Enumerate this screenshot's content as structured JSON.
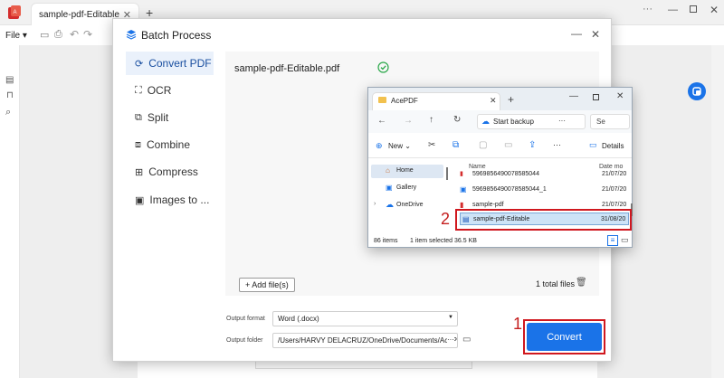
{
  "app": {
    "tab_title": "sample-pdf-Editable",
    "new_tab": "+",
    "menu_file": "File",
    "window_more": "···"
  },
  "dialog": {
    "title": "Batch Process",
    "nav": [
      {
        "label": "Convert PDF",
        "icon": "convert-icon",
        "active": true
      },
      {
        "label": "OCR",
        "icon": "ocr-icon"
      },
      {
        "label": "Split",
        "icon": "split-icon"
      },
      {
        "label": "Combine",
        "icon": "combine-icon"
      },
      {
        "label": "Compress",
        "icon": "compress-icon"
      },
      {
        "label": "Images to ...",
        "icon": "images-icon"
      }
    ],
    "file_name": "sample-pdf-Editable.pdf",
    "add_files": "+ Add file(s)",
    "total_files": "1 total files",
    "output_format_label": "Output format",
    "output_format_value": "Word (.docx)",
    "output_folder_label": "Output folder",
    "output_folder_value": "/Users/HARVY DELACRUZ/OneDrive/Documents/AcePDF",
    "folder_more": "···",
    "convert": "Convert",
    "annotation_1": "1",
    "annotation_2": "2"
  },
  "explorer": {
    "title": "AcePDF",
    "new_tab": "+",
    "address": "Start backup",
    "address_more": "···",
    "search_stub": "Se",
    "new_label": "New",
    "details_label": "Details",
    "more": "···",
    "sidebar": [
      {
        "label": "Home",
        "icon": "home-icon",
        "active": true
      },
      {
        "label": "Gallery",
        "icon": "gallery-icon"
      },
      {
        "label": "OneDrive",
        "icon": "onedrive-icon"
      }
    ],
    "col_name": "Name",
    "col_date": "Date mo",
    "files": [
      {
        "name": "5969856490078585044",
        "date": "21/07/20"
      },
      {
        "name": "5969856490078585044_1",
        "date": "21/07/20"
      },
      {
        "name": "sample-pdf",
        "date": "21/07/20"
      },
      {
        "name": "sample-pdf-Editable",
        "date": "31/08/20",
        "selected": true
      }
    ],
    "status_items": "86 items",
    "status_selected": "1 item selected",
    "status_size": "36.5 KB"
  },
  "colors": {
    "accent": "#1a73e8",
    "brand_red": "#d42d2d",
    "annotation": "#c41d1d",
    "success": "#2ba84a"
  }
}
